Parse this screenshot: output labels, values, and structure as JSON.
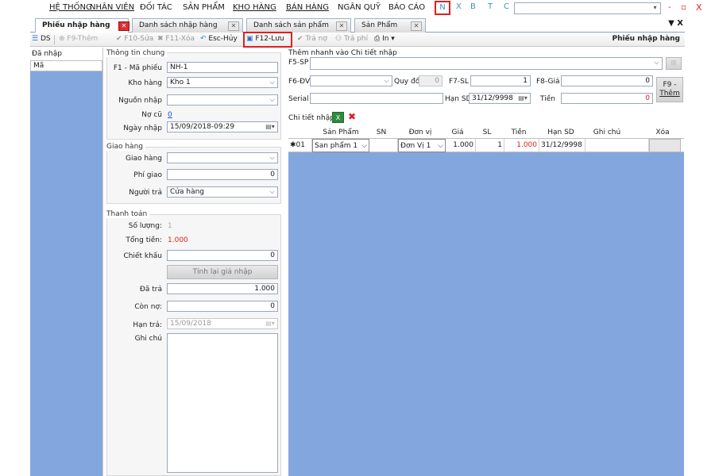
{
  "menu": {
    "items": [
      "HỆ THỐNG",
      "NHÂN VIÊN",
      "ĐỐI TÁC",
      "SẢN PHẨM",
      "KHO HÀNG",
      "BÁN HÀNG",
      "NGÂN QUỸ",
      "BÁO CÁO"
    ],
    "quick": [
      "N",
      "X",
      "B",
      "T",
      "C"
    ],
    "window_controls": [
      "-",
      "▫",
      "X"
    ]
  },
  "tabs": [
    {
      "label": "Phiếu nhập hàng",
      "active": true
    },
    {
      "label": "Danh sách nhập hàng",
      "active": false
    },
    {
      "label": "Danh sách sản phẩm",
      "active": false
    },
    {
      "label": "Sản Phẩm",
      "active": false
    }
  ],
  "tab_controls": "▼ X",
  "toolbar": {
    "ds": "DS",
    "add": "F9-Thêm",
    "edit": "F10-Sửa",
    "delete": "F11-Xóa",
    "cancel": "Esc-Hủy",
    "save": "F12-Lưu",
    "pay_debt": "Trả nợ",
    "pay_fee": "Trả phí",
    "print": "In",
    "title": "Phiếu nhập hàng"
  },
  "left": {
    "header": "Đã nhập",
    "column": "Mã"
  },
  "general": {
    "title": "Thông tin chung",
    "code_label": "F1 - Mã phiếu",
    "code_value": "NH-1",
    "warehouse_label": "Kho hàng",
    "warehouse_value": "Kho 1",
    "source_label": "Nguồn nhập",
    "source_value": "",
    "old_debt_label": "Nợ cũ",
    "old_debt_value": "0",
    "date_label": "Ngày nhập",
    "date_value": "15/09/2018-09:29"
  },
  "delivery": {
    "title": "Giao hàng",
    "shipper_label": "Giao hàng",
    "shipper_value": "",
    "fee_label": "Phí giao",
    "fee_value": "0",
    "payer_label": "Người trả",
    "payer_value": "Cửa hàng"
  },
  "payment": {
    "title": "Thanh toán",
    "qty_label": "Số lượng:",
    "qty_value": "1",
    "total_label": "Tổng tiền:",
    "total_value": "1.000",
    "discount_label": "Chiết khấu",
    "discount_value": "0",
    "recalc_button": "Tính lại giá nhập",
    "paid_label": "Đã trả",
    "paid_value": "1.000",
    "remaining_label": "Còn nợ:",
    "remaining_value": "0",
    "due_label": "Hạn trả:",
    "due_value": "15/09/2018",
    "note_label": "Ghi chú"
  },
  "quick_add": {
    "title": "Thêm nhanh vào Chi tiết nhập",
    "product_label": "F5-SP",
    "unit_label": "F6-ĐV",
    "convert_label": "Quy đổi",
    "convert_value": "0",
    "qty_label": "F7-SL",
    "qty_value": "1",
    "price_label": "F8-Giá",
    "price_value": "0",
    "serial_label": "Serial",
    "expiry_label": "Hạn SD",
    "expiry_value": "31/12/9998",
    "amount_label": "Tiền",
    "amount_value": "0",
    "add_button_line1": "F9 -",
    "add_button_line2": "Thêm"
  },
  "detail": {
    "title": "Chi tiết nhập",
    "columns": [
      "Sản Phẩm",
      "SN",
      "Đơn vị",
      "Giá",
      "SL",
      "Tiền",
      "Hạn SD",
      "Ghi chú",
      "Xóa"
    ],
    "rows": [
      {
        "no": "01",
        "product": "San phẩm 1",
        "sn": "",
        "unit": "Đơn Vị 1",
        "price": "1.000",
        "qty": "1",
        "amount": "1.000",
        "expiry": "31/12/9998",
        "note": ""
      }
    ]
  }
}
